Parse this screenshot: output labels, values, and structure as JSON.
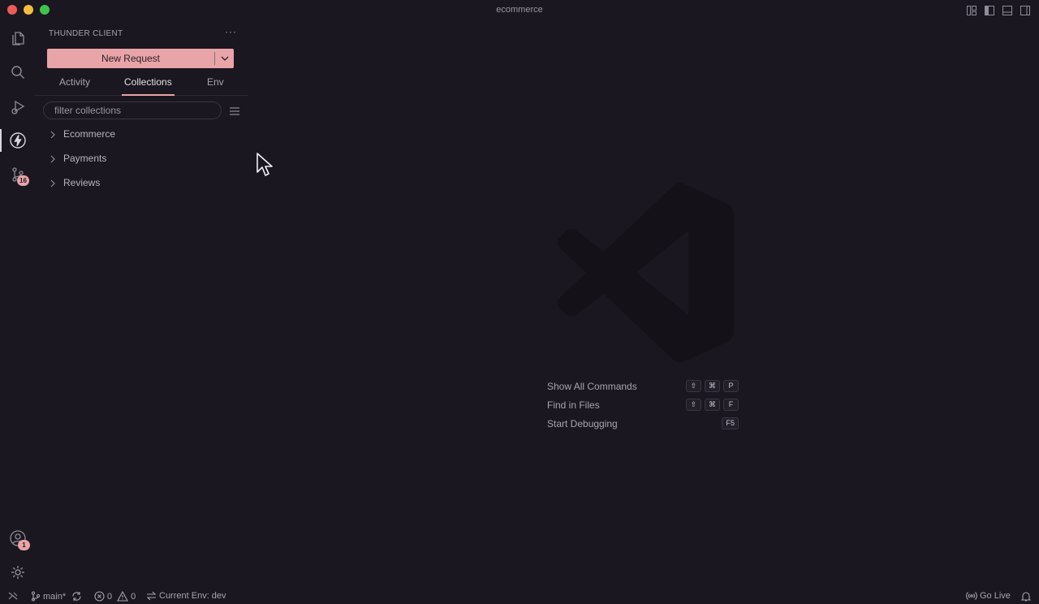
{
  "window": {
    "title": "ecommerce"
  },
  "activity_bar": {
    "source_control_badge": "16",
    "accounts_badge": "1"
  },
  "sidebar": {
    "title": "THUNDER CLIENT",
    "more": "···",
    "new_request_label": "New Request",
    "tabs": [
      "Activity",
      "Collections",
      "Env"
    ],
    "active_tab": "Collections",
    "filter_placeholder": "filter collections",
    "collections": [
      "Ecommerce",
      "Payments",
      "Reviews"
    ]
  },
  "editor": {
    "commands": [
      {
        "label": "Show All Commands",
        "keys": [
          "⇧",
          "⌘",
          "P"
        ]
      },
      {
        "label": "Find in Files",
        "keys": [
          "⇧",
          "⌘",
          "F"
        ]
      },
      {
        "label": "Start Debugging",
        "keys": [
          "F5"
        ]
      }
    ]
  },
  "statusbar": {
    "branch": "main*",
    "errors": "0",
    "warnings": "0",
    "env": "Current Env: dev",
    "go_live": "Go Live"
  },
  "colors": {
    "accent": "#e9a4a7",
    "background": "#1a1720"
  }
}
